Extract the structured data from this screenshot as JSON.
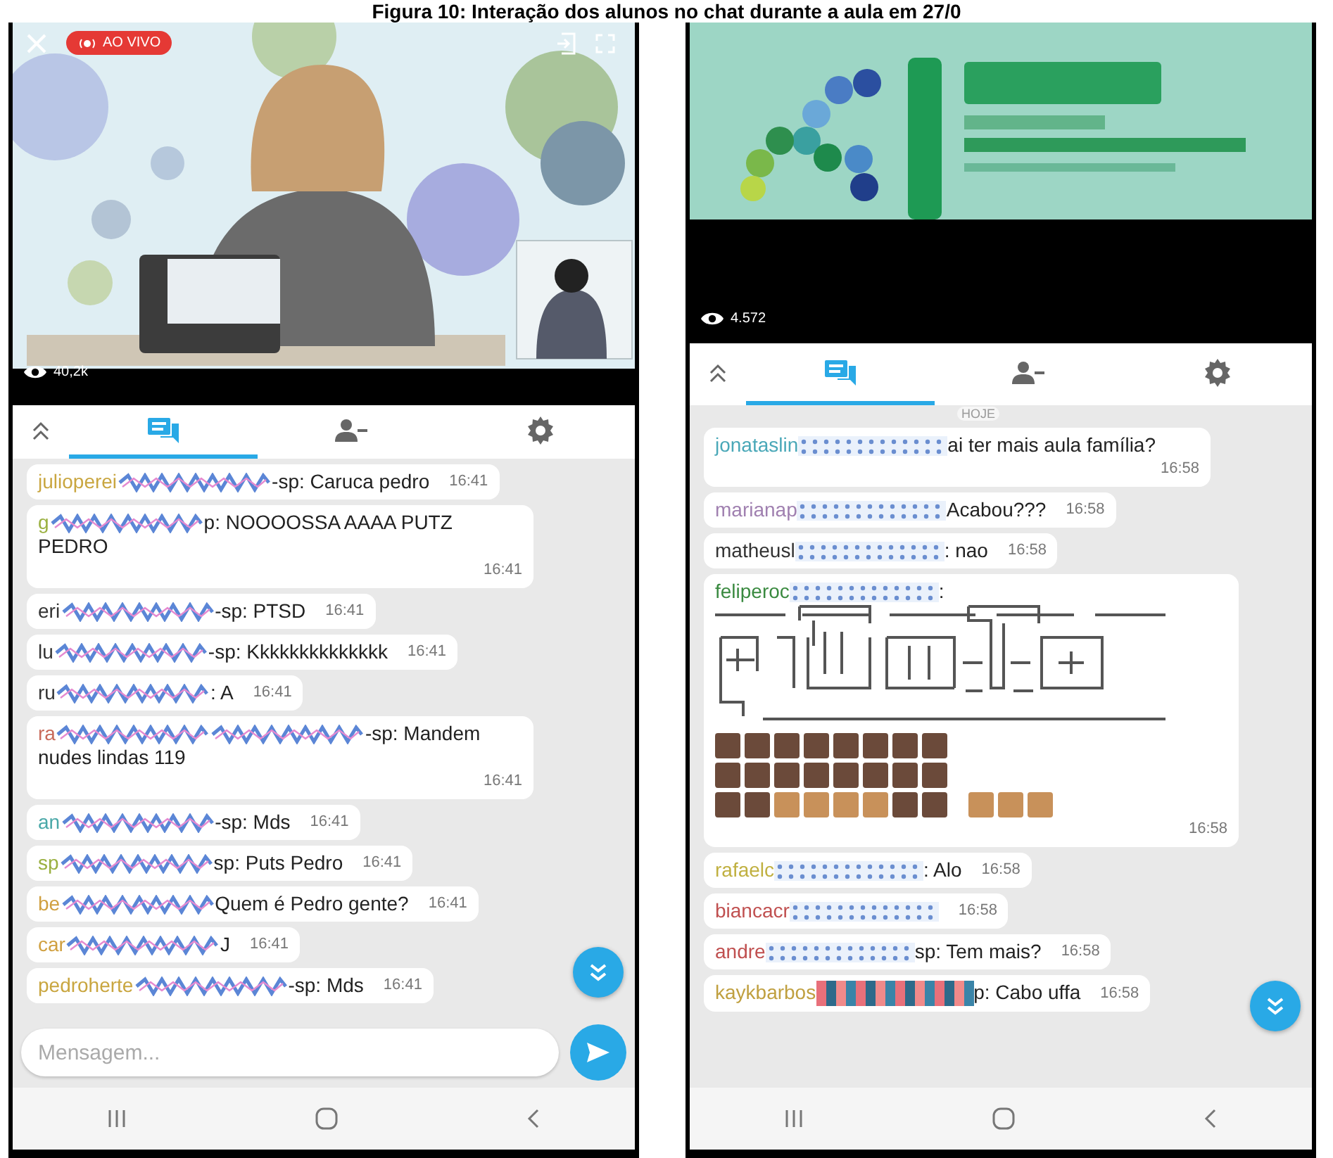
{
  "caption": "Figura 10: Interação dos alunos no chat durante a aula em 27/0",
  "phones": [
    {
      "video": {
        "kind": "classroom"
      },
      "live_badge": "AO VIVO",
      "viewers": "40,2k",
      "tabs": [
        {
          "selected": false
        },
        {
          "selected": true
        },
        {
          "selected": false
        },
        {
          "selected": false
        }
      ],
      "messages": [
        {
          "kind": "scribbled",
          "user": "julioperei",
          "color": "#c9a640",
          "text": "-sp: Caruca pedro",
          "tail_hidden": false,
          "time": "16:41"
        },
        {
          "kind": "scribbled",
          "user": "g",
          "color": "#9ab040",
          "text": "p: NOOOOSSA AAAA PUTZ PEDRO",
          "tail_hidden": false,
          "time": "16:41"
        },
        {
          "kind": "scribbled",
          "user": "eri",
          "color": "#333333",
          "text": "-sp: PTSD",
          "tail_hidden": false,
          "time": "16:41"
        },
        {
          "kind": "scribbled",
          "user": "lu",
          "color": "#333333",
          "text": "-sp: Kkkkkkkkkkkkkk",
          "tail_hidden": false,
          "time": "16:41"
        },
        {
          "kind": "scribbled",
          "user": "ru",
          "color": "#333333",
          "text": ": A",
          "tail_hidden": false,
          "time": "16:41"
        },
        {
          "kind": "scribbled",
          "user": "ra",
          "color": "#c86a5a",
          "text": "-sp: Mandem nudes lindas 119",
          "tail_hidden": true,
          "time": "16:41"
        },
        {
          "kind": "scribbled",
          "user": "an",
          "color": "#4aa8a8",
          "text": "-sp: Mds",
          "tail_hidden": false,
          "time": "16:41"
        },
        {
          "kind": "scribbled",
          "user": "sp",
          "color": "#9ab040",
          "text": "sp: Puts Pedro",
          "tail_hidden": false,
          "time": "16:41"
        },
        {
          "kind": "scribbled",
          "user": "be",
          "color": "#d0a040",
          "text": "Quem é Pedro gente?",
          "tail_hidden": false,
          "time": "16:41"
        },
        {
          "kind": "scribbled",
          "user": "car",
          "color": "#d0a040",
          "text": "J",
          "tail_hidden": false,
          "time": "16:41"
        },
        {
          "kind": "scribbled",
          "user": "pedroherte",
          "color": "#c9a640",
          "text": "-sp: Mds",
          "tail_hidden": false,
          "time": "16:41"
        }
      ],
      "message_field": {
        "placeholder": "Mensagem..."
      }
    },
    {
      "video": {
        "kind": "banner"
      },
      "viewers": "4.572",
      "tabs": [
        {
          "selected": false
        },
        {
          "selected": true
        },
        {
          "selected": false
        },
        {
          "selected": false
        }
      ],
      "date_chip": "HOJE",
      "messages": [
        {
          "kind": "dotted",
          "user": "jonataslin",
          "color": "#4aa8b8",
          "text": "ai ter mais aula família?",
          "tail_hidden": false,
          "time": "16:58"
        },
        {
          "kind": "dotted",
          "user": "marianap",
          "color": "#a080b0",
          "text": "Acabou???",
          "tail_hidden": false,
          "time": "16:58"
        },
        {
          "kind": "dotted",
          "user": "matheusl",
          "color": "#333333",
          "text": ": nao",
          "tail_hidden": false,
          "time": "16:58"
        },
        {
          "kind": "art",
          "user": "feliperoc",
          "color": "#3a8a40",
          "text": ":",
          "tail_hidden": false,
          "time": "16:58"
        },
        {
          "kind": "dotted",
          "user": "rafaelc",
          "color": "#c0b040",
          "text": ": Alo",
          "tail_hidden": false,
          "time": "16:58"
        },
        {
          "kind": "dotted",
          "user": "biancacr",
          "color": "#c05050",
          "tail_hidden": false,
          "time": "16:58"
        },
        {
          "kind": "dotted",
          "user": "andre",
          "color": "#c05050",
          "text": "sp: Tem mais?",
          "tail_hidden": false,
          "time": "16:58"
        },
        {
          "kind": "striped",
          "user": "kaykbarbos",
          "color": "#c0a040",
          "text": "p: Cabo uffa",
          "tail_hidden": false,
          "time": "16:58"
        }
      ]
    }
  ]
}
